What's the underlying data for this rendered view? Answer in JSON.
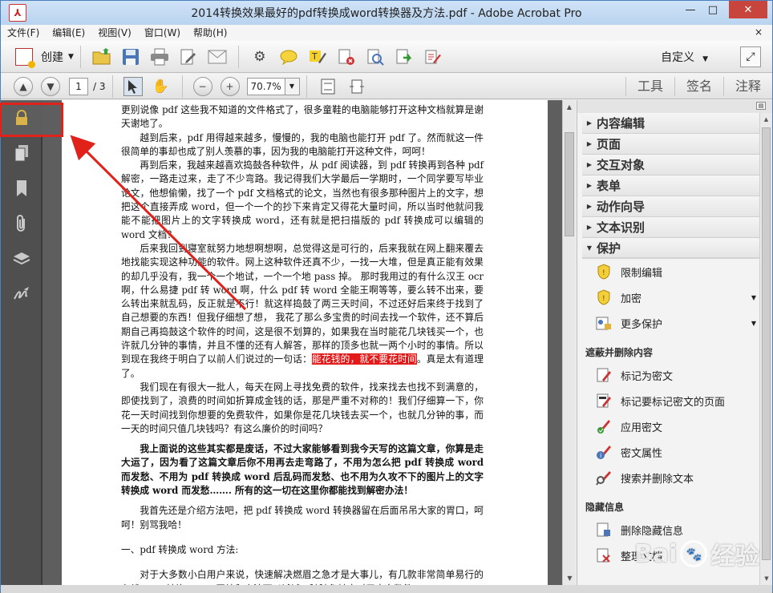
{
  "window": {
    "title": "2014转换效果最好的pdf转换成word转换器及方法.pdf - Adobe Acrobat Pro",
    "min": "—",
    "max": "□",
    "close": "✕"
  },
  "menu": {
    "items": [
      "文件(F)",
      "编辑(E)",
      "视图(V)",
      "窗口(W)",
      "帮助(H)"
    ],
    "close": "×"
  },
  "toolbar": {
    "create_label": "创建",
    "custom_label": "自定义"
  },
  "nav": {
    "page_current": "1",
    "page_total": "/ 3",
    "zoom": "70.7%"
  },
  "tabs": [
    "工具",
    "签名",
    "注释"
  ],
  "document": {
    "paragraphs": [
      {
        "text": "更别说像 pdf 这些我不知道的文件格式了，很多童鞋的电脑能够打开这种文档就算是谢天谢地了。",
        "style": "noind"
      },
      {
        "text": "越到后来，pdf 用得越来越多，慢慢的，我的电脑也能打开 pdf 了。然而就这一件很简单的事却也成了别人羡慕的事，因为我的电脑能打开这种文件，呵呵！",
        "style": ""
      },
      {
        "text": "再到后来，我越来越喜欢捣鼓各种软件，从 pdf 阅读器，到 pdf 转换再到各种 pdf 解密，一路走过来，走了不少弯路。我记得我们大学最后一学期时，一个同学要写毕业论文，他想偷懒，找了一个 pdf 文档格式的论文，当然也有很多那种图片上的文字，想把这个直接弄成 word，但一个一个的抄下来肯定又得花大量时间，所以当时他就问我能不能把图片上的文字转换成 word，还有就是把扫描版的 pdf 转换成可以编辑的 word 文档？",
        "style": ""
      },
      {
        "text": "后来我回到寝室就努力地想啊想啊，总觉得这是可行的，后来我就在网上翻来覆去地找能实现这种功能的软件。网上这种软件还真不少，一找一大堆，但是真正能有效果的却几乎没有，我一个一个地试，一个一个地 pass 掉。 那时我用过的有什么汉王 ocr 啊，什么易捷 pdf 转 word 啊，什么 pdf 转 word 全能王啊等等，要么转不出来，要么转出来就乱码，反正就是不行！就这样捣鼓了两三天时间，不过还好后来终于找到了自己想要的东西！但我仔细想了想， 我花了那么多宝贵的时间去找一个软件，还不算后期自己再捣鼓这个软件的时间，这是很不划算的，如果我在当时能花几块钱买一个，也许就几分钟的事情，并且不懂的还有人解答，那样的顶多也就一两个小时的事情。所以到现在我终于明白了以前人们说过的一句话：",
        "style": "",
        "highlight": "能花钱的，就不要花时间",
        "after": "。真是太有道理了。"
      },
      {
        "text": "我们现在有很大一批人，每天在网上寻找免费的软件，找来找去也找不到满意的，即使找到了，浪费的时间如折算成金钱的话，那是严重不对称的！我们仔细算一下，你花一天时间找到你想要的免费软件，如果你是花几块钱去买一个，也就几分钟的事，而一天的时间只值几块钱吗？有这么廉价的时间吗？",
        "style": ""
      },
      {
        "text": "我上面说的这些其实都是废话，不过大家能够看到我今天写的这篇文章，你算是走大运了，因为看了这篇文章后你不用再去走弯路了，不用为怎么把 pdf 转换成 word 而发愁、不用为 pdf 转换成 word 后乱码而发愁、也不用为久攻不下的图片上的文字转换成 word 而发愁……. 所有的这一切在这里你都能找到解密办法！",
        "style": "bold sp"
      },
      {
        "text": "我首先还是介绍方法吧，把 pdf 转换成 word 转换器留在后面吊吊大家的胃口，呵呵！别骂我哈！",
        "style": "sp"
      },
      {
        "text": "一、pdf 转换成 word 方法:",
        "style": "noind sp2"
      },
      {
        "text": "对于大多数小白用户来说，快速解决燃眉之急才是大事儿，有几款非常简单易行的在线 PDF 转换 Word 网站和方法可以试试，随随急转变对于大多数简",
        "style": "sp2"
      }
    ]
  },
  "panel": {
    "sections": [
      "内容编辑",
      "页面",
      "交互对象",
      "表单",
      "动作向导",
      "文本识别"
    ],
    "open_section": "保护",
    "protect_items": [
      {
        "label": "限制编辑",
        "icon": "shield-icon",
        "dropdown": false
      },
      {
        "label": "加密",
        "icon": "shield-icon",
        "dropdown": true
      },
      {
        "label": "更多保护",
        "icon": "more-protect-icon",
        "dropdown": true
      }
    ],
    "redact_title": "遮蔽并删除内容",
    "redact_items": [
      {
        "label": "标记为密文",
        "icon": "mark-redaction-icon"
      },
      {
        "label": "标记要标记密文的页面",
        "icon": "mark-pages-icon"
      },
      {
        "label": "应用密文",
        "icon": "apply-redaction-icon"
      },
      {
        "label": "密文属性",
        "icon": "redaction-properties-icon"
      },
      {
        "label": "搜索并删除文本",
        "icon": "search-remove-icon"
      }
    ],
    "hidden_title": "隐藏信息",
    "hidden_items": [
      {
        "label": "删除隐藏信息",
        "icon": "remove-hidden-icon"
      },
      {
        "label": "整理文档",
        "icon": "sanitize-icon"
      }
    ]
  },
  "watermark": {
    "text1": "Bai",
    "text2": "经验"
  },
  "colors": {
    "highlight": "#e31a1a",
    "annotation": "#e0221b",
    "nav_bg": "#4f4f4f"
  }
}
